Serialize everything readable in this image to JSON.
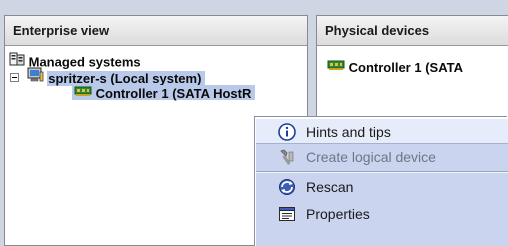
{
  "left_pane": {
    "header": "Enterprise view",
    "tree": {
      "root_label": "Managed systems",
      "system_label": "spritzer-s (Local system)",
      "controller_label": "Controller 1 (SATA HostR"
    }
  },
  "right_pane": {
    "header": "Physical devices",
    "controller_label": "Controller 1 (SATA"
  },
  "context_menu": {
    "items": [
      {
        "label": "Hints and tips",
        "icon": "info-icon",
        "state": "highlighted"
      },
      {
        "label": "Create logical device",
        "icon": "wand-icon",
        "state": "disabled"
      },
      {
        "label": "Rescan",
        "icon": "rescan-icon",
        "state": "normal"
      },
      {
        "label": "Properties",
        "icon": "properties-icon",
        "state": "normal"
      }
    ]
  },
  "colors": {
    "selection": "#b9c9ea",
    "menu_bg": "#cad4ee",
    "menu_highlight": "#e6ecfa"
  }
}
